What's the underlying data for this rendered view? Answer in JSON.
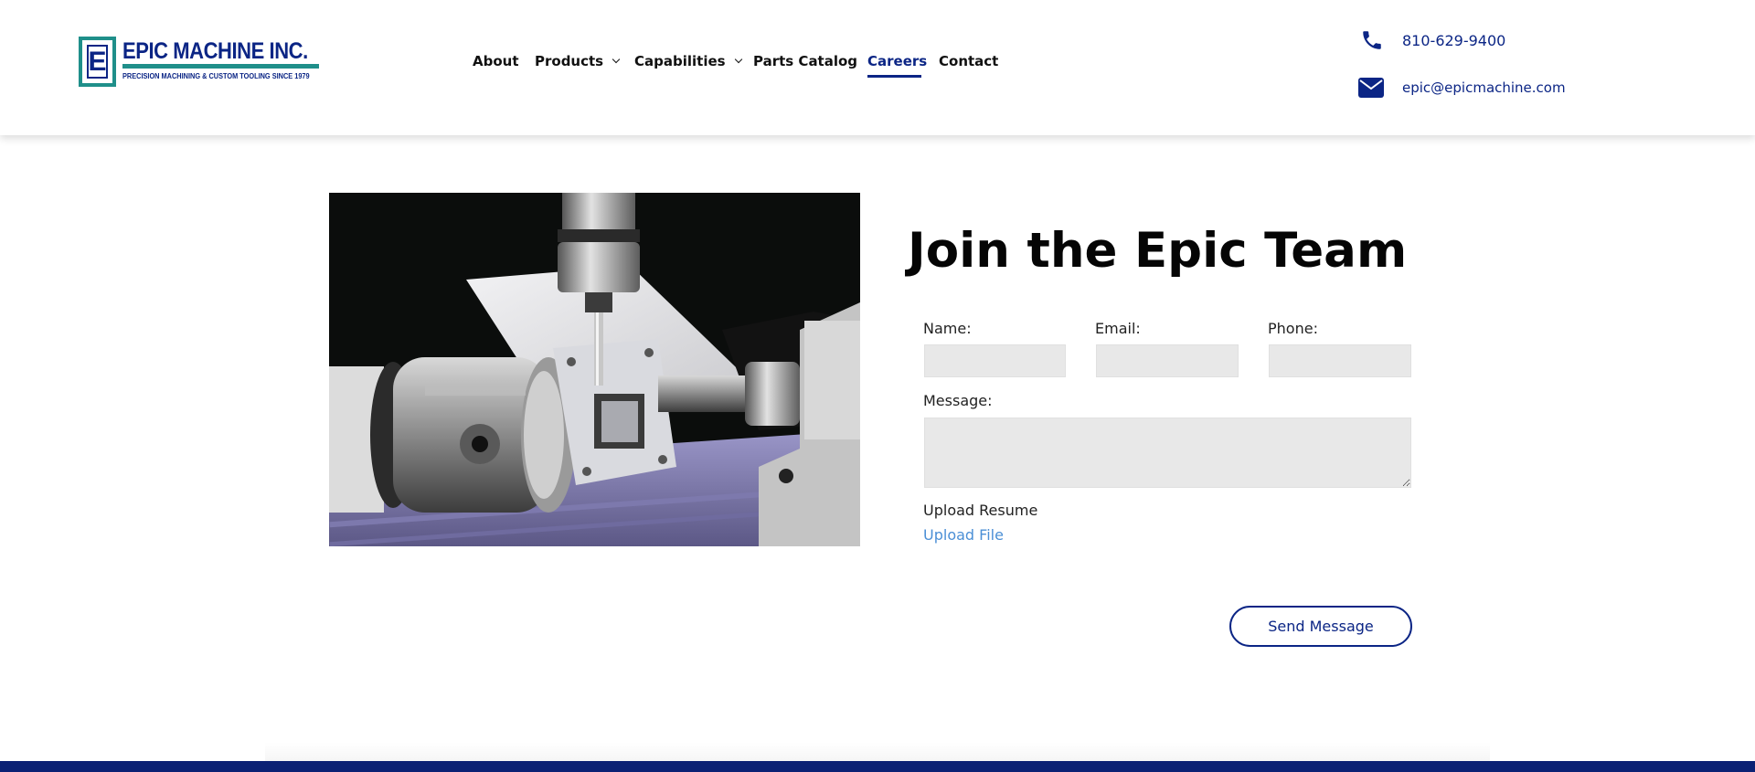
{
  "brand": {
    "logo_letter": "E",
    "name": "EPIC MACHINE INC.",
    "tagline": "PRECISION MACHINING & CUSTOM TOOLING SINCE 1979",
    "primary_color": "#0b2585",
    "accent_color": "#1f8f8a"
  },
  "nav": {
    "items": [
      {
        "label": "About",
        "has_dropdown": false
      },
      {
        "label": "Products",
        "has_dropdown": true
      },
      {
        "label": "Capabilities",
        "has_dropdown": true
      },
      {
        "label": "Parts Catalog",
        "has_dropdown": false
      },
      {
        "label": "Careers",
        "has_dropdown": false,
        "active": true
      },
      {
        "label": "Contact",
        "has_dropdown": false
      }
    ]
  },
  "contact": {
    "phone": "810-629-9400",
    "phone_icon": "phone-icon",
    "email": "epic@epicmachine.com",
    "email_icon": "envelope-icon"
  },
  "main": {
    "image": "cnc-machining-photo",
    "heading": "Join the Epic Team",
    "form": {
      "name_label": "Name:",
      "name_value": "",
      "email_label": "Email:",
      "email_value": "",
      "phone_label": "Phone:",
      "phone_value": "",
      "message_label": "Message:",
      "message_value": "",
      "upload_label": "Upload Resume",
      "upload_link": "Upload File",
      "submit_label": "Send Message"
    }
  },
  "footer": {
    "bar_color": "#0b2174"
  }
}
